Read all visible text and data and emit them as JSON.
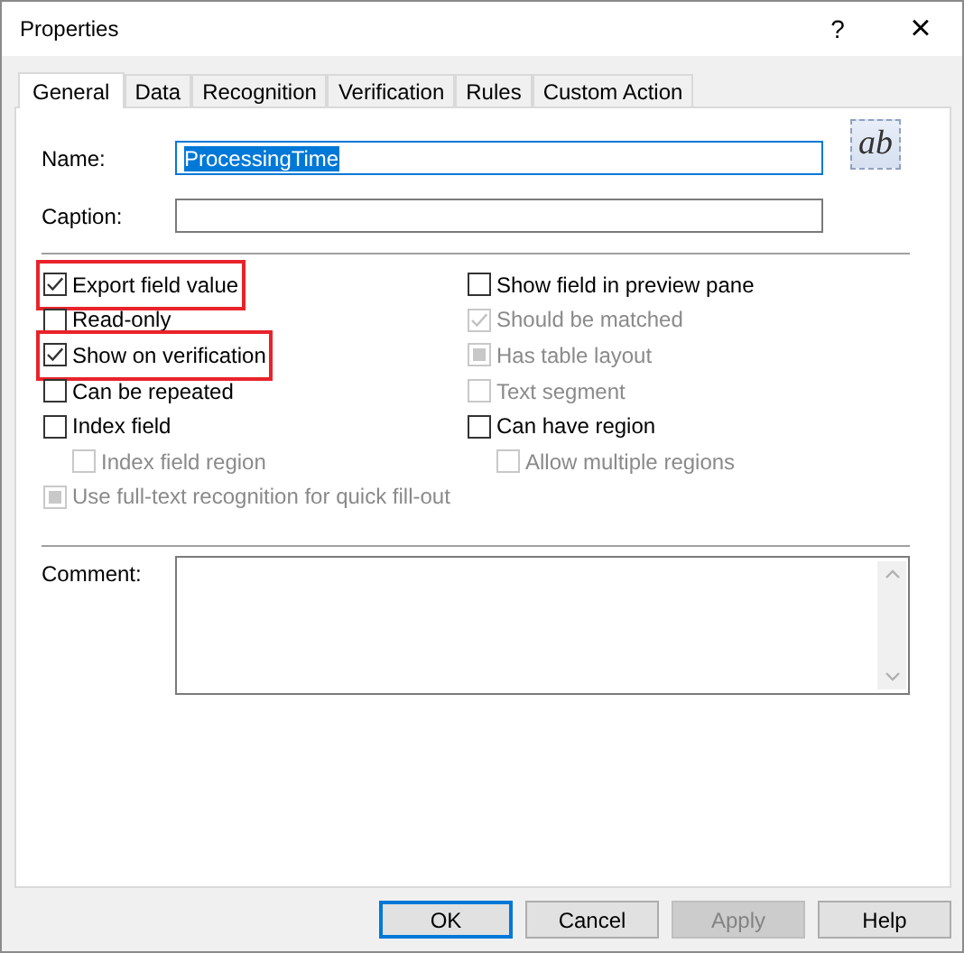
{
  "window": {
    "title": "Properties",
    "help": "?",
    "close": "×"
  },
  "tabs": [
    {
      "label": "General",
      "selected": true
    },
    {
      "label": "Data",
      "selected": false
    },
    {
      "label": "Recognition",
      "selected": false
    },
    {
      "label": "Verification",
      "selected": false
    },
    {
      "label": "Rules",
      "selected": false
    },
    {
      "label": "Custom Action",
      "selected": false
    }
  ],
  "name_field": {
    "label": "Name:",
    "value": "ProcessingTime",
    "text_selected": true,
    "focused": true
  },
  "caption_field": {
    "label": "Caption:"
  },
  "type_button": {
    "label": "ab"
  },
  "options_left": [
    {
      "label": "Export field value",
      "checked": true,
      "mixed": false,
      "disabled": false,
      "highlighted": true,
      "indented": false
    },
    {
      "label": "Read-only",
      "checked": false,
      "mixed": false,
      "disabled": false,
      "highlighted": false,
      "indented": false
    },
    {
      "label": "Show on verification",
      "checked": true,
      "mixed": false,
      "disabled": false,
      "highlighted": true,
      "indented": false
    },
    {
      "label": "Can be repeated",
      "checked": false,
      "mixed": false,
      "disabled": false,
      "highlighted": false,
      "indented": false
    },
    {
      "label": "Index field",
      "checked": false,
      "mixed": false,
      "disabled": false,
      "highlighted": false,
      "indented": false
    },
    {
      "label": "Index field region",
      "checked": false,
      "mixed": false,
      "disabled": true,
      "highlighted": false,
      "indented": true
    },
    {
      "label": "Use full-text recognition for quick fill-out",
      "checked": false,
      "mixed": true,
      "disabled": true,
      "highlighted": false,
      "indented": false
    }
  ],
  "options_right": [
    {
      "label": "Show field in preview pane",
      "checked": false,
      "mixed": false,
      "disabled": false,
      "highlighted": false,
      "indented": false
    },
    {
      "label": "Should be matched",
      "checked": true,
      "mixed": false,
      "disabled": true,
      "highlighted": false,
      "indented": false
    },
    {
      "label": "Has table layout",
      "checked": false,
      "mixed": true,
      "disabled": true,
      "highlighted": false,
      "indented": false
    },
    {
      "label": "Text segment",
      "checked": false,
      "mixed": false,
      "disabled": true,
      "highlighted": false,
      "indented": false
    },
    {
      "label": "Can have region",
      "checked": false,
      "mixed": false,
      "disabled": false,
      "highlighted": false,
      "indented": false
    },
    {
      "label": "Allow multiple regions",
      "checked": false,
      "mixed": false,
      "disabled": true,
      "highlighted": false,
      "indented": true
    }
  ],
  "comment_field": {
    "label": "Comment:"
  },
  "buttons": [
    {
      "label": "OK",
      "default": true,
      "disabled": false
    },
    {
      "label": "Cancel",
      "default": false,
      "disabled": false
    },
    {
      "label": "Apply",
      "default": false,
      "disabled": true
    },
    {
      "label": "Help",
      "default": false,
      "disabled": false
    }
  ]
}
